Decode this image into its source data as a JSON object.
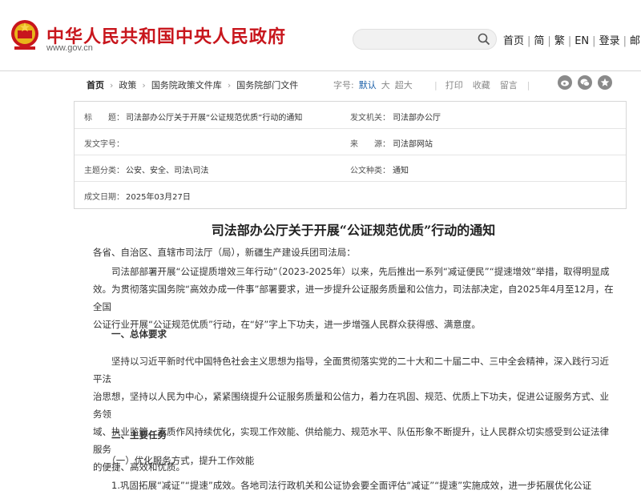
{
  "header": {
    "site_title": "中华人民共和国中央人民政府",
    "site_url": "www.gov.cn",
    "links": [
      "首页",
      "简",
      "繁",
      "EN",
      "登录",
      "邮"
    ]
  },
  "breadcrumb": {
    "items": [
      "首页",
      "政策",
      "国务院政策文件库",
      "国务院部门文件"
    ]
  },
  "font_size": {
    "label": "字号:",
    "options": [
      "默认",
      "大",
      "超大"
    ],
    "selected": "默认"
  },
  "tools": {
    "print": "打印",
    "favorite": "收藏",
    "comment": "留言"
  },
  "info": {
    "title_label": "标　　题：",
    "title_value": "司法部办公厅关于开展“公证规范优质”行动的通知",
    "issuer_label": "发文机关：",
    "issuer_value": "司法部办公厅",
    "docno_label": "发文字号：",
    "docno_value": "",
    "source_label": "来　　源：",
    "source_value": "司法部网站",
    "topic_label": "主题分类：",
    "topic_value": "公安、安全、司法\\司法",
    "type_label": "公文种类：",
    "type_value": "通知",
    "date_label": "成文日期：",
    "date_value": "2025年03月27日"
  },
  "article": {
    "title": "司法部办公厅关于开展“公证规范优质”行动的通知",
    "salutation": "各省、自治区、直辖市司法厅（局），新疆生产建设兵团司法局：",
    "p1": [
      "　　司法部部署开展“公证提质增效三年行动”（2023-2025年）以来，先后推出一系列“减证便民”“提速增效”举措，取得明显成",
      "效。为贯彻落实国务院“高效办成一件事”部署要求，进一步提升公证服务质量和公信力，司法部决定，自2025年4月至12月，在全国",
      "公证行业开展“公证规范优质”行动，在“好”字上下功夫，进一步增强人民群众获得感、满意度。"
    ],
    "h1": "　　一、总体要求",
    "p2": [
      "　　坚持以习近平新时代中国特色社会主义思想为指导，全面贯彻落实党的二十大和二十届二中、三中全会精神，深入践行习近平法",
      "治思想，坚持以人民为中心，紧紧围绕提升公证服务质量和公信力，着力在巩固、规范、优质上下功夫，促进公证服务方式、业务领",
      "域、执业监管、素质作风持续优化，实现工作效能、供给能力、规范水平、队伍形象不断提升，让人民群众切实感受到公证法律服务",
      "的便捷、高效和优质。"
    ],
    "h2": "　　二、主要任务",
    "h3": "　　（一）优化服务方式，提升工作效能",
    "p3": [
      "　　1.巩固拓展“减证”“提速”成效。各地司法行政机关和公证协会要全面评估“减证”“提速”实施成效，进一步拓展优化公证"
    ]
  }
}
